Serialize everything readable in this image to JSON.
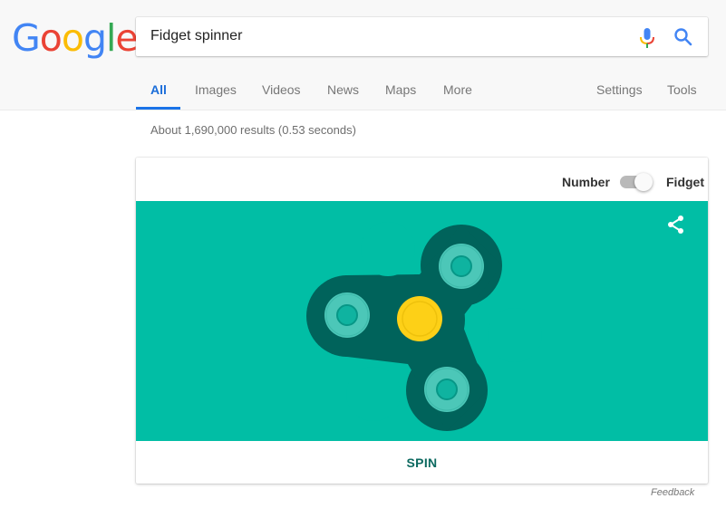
{
  "logo": {
    "text": "Google",
    "letters": [
      {
        "char": "G",
        "color": "#4285F4"
      },
      {
        "char": "o",
        "color": "#EA4335"
      },
      {
        "char": "o",
        "color": "#FBBC05"
      },
      {
        "char": "g",
        "color": "#4285F4"
      },
      {
        "char": "l",
        "color": "#34A853"
      },
      {
        "char": "e",
        "color": "#EA4335"
      }
    ]
  },
  "search": {
    "query": "Fidget spinner",
    "mic_icon": "microphone-icon",
    "search_icon": "search-icon"
  },
  "tabs": [
    {
      "label": "All",
      "active": true
    },
    {
      "label": "Images",
      "active": false
    },
    {
      "label": "Videos",
      "active": false
    },
    {
      "label": "News",
      "active": false
    },
    {
      "label": "Maps",
      "active": false
    },
    {
      "label": "More",
      "active": false
    }
  ],
  "tools": {
    "settings": "Settings",
    "tools": "Tools"
  },
  "stats": "About 1,690,000 results (0.53 seconds)",
  "widget": {
    "toggle_left_label": "Number",
    "toggle_right_label": "Fidget",
    "toggle_state": "Fidget",
    "share_icon": "share-icon",
    "spin_label": "SPIN",
    "colors": {
      "background": "#01BEA5",
      "body": "#00635B",
      "bearing_outer": "#4CC7B8",
      "bearing_hole": "#0FB3A0",
      "center_cap": "#FDD017"
    }
  },
  "feedback": "Feedback",
  "accent_color": "#1A73E8"
}
